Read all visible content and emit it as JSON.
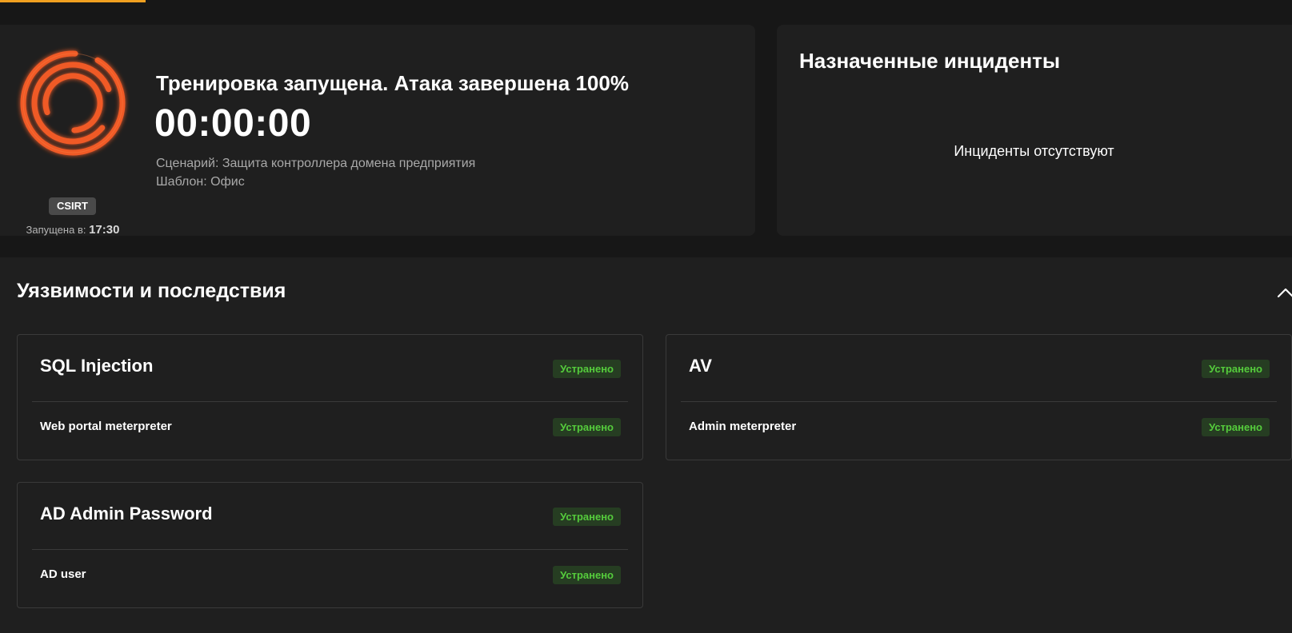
{
  "training": {
    "title": "Тренировка запущена. Атака завершена 100%",
    "timer": "00:00:00",
    "scenario": "Сценарий: Защита контроллера домена предприятия",
    "template": "Шаблон: Офис",
    "team_badge": "CSIRT",
    "started_label": "Запущена в:",
    "started_time": "17:30",
    "progress_percent": 100,
    "logo_icon": "concentric-circles-logo-icon",
    "accent_color": "#f05a28"
  },
  "incidents": {
    "title": "Назначенные инциденты",
    "empty_text": "Инциденты отсутствуют"
  },
  "vulnerabilities": {
    "title": "Уязвимости и последствия",
    "toggle_icon": "chevron-up-icon",
    "status_color": "#55cc3c",
    "items": [
      {
        "name": "SQL Injection",
        "status": "Устранено",
        "consequences": [
          {
            "name": "Web portal meterpreter",
            "status": "Устранено"
          }
        ]
      },
      {
        "name": "AV",
        "status": "Устранено",
        "consequences": [
          {
            "name": "Admin meterpreter",
            "status": "Устранено"
          }
        ]
      },
      {
        "name": "AD Admin Password",
        "status": "Устранено",
        "consequences": [
          {
            "name": "AD user",
            "status": "Устранено"
          }
        ]
      }
    ]
  }
}
